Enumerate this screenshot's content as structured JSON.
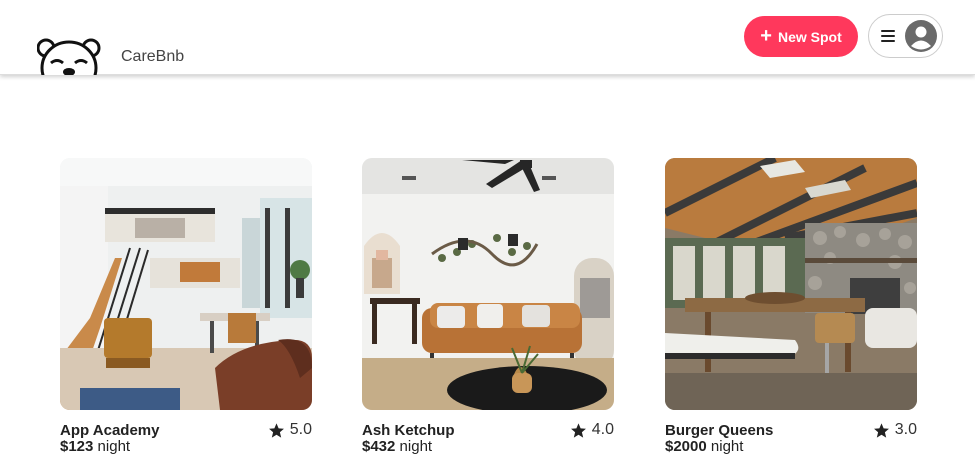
{
  "header": {
    "brand": "CareBnb",
    "logo_icon": "bear-icon",
    "new_spot_label": "New Spot",
    "new_spot_icon": "plus-icon",
    "menu_icon": "hamburger-icon",
    "profile_icon": "user-avatar-icon"
  },
  "colors": {
    "accent": "#ff385c",
    "text": "#222222",
    "avatar": "#6a6a6a"
  },
  "spots": [
    {
      "name": "App Academy",
      "price": "$123",
      "unit": "night",
      "rating": "5.0",
      "image_icon": "bright-loft-living-room-image"
    },
    {
      "name": "Ash Ketchup",
      "price": "$432",
      "unit": "night",
      "rating": "4.0",
      "image_icon": "leather-sofa-living-room-image"
    },
    {
      "name": "Burger Queens",
      "price": "$2000",
      "unit": "night",
      "rating": "3.0",
      "image_icon": "wood-beam-dining-room-image"
    }
  ]
}
